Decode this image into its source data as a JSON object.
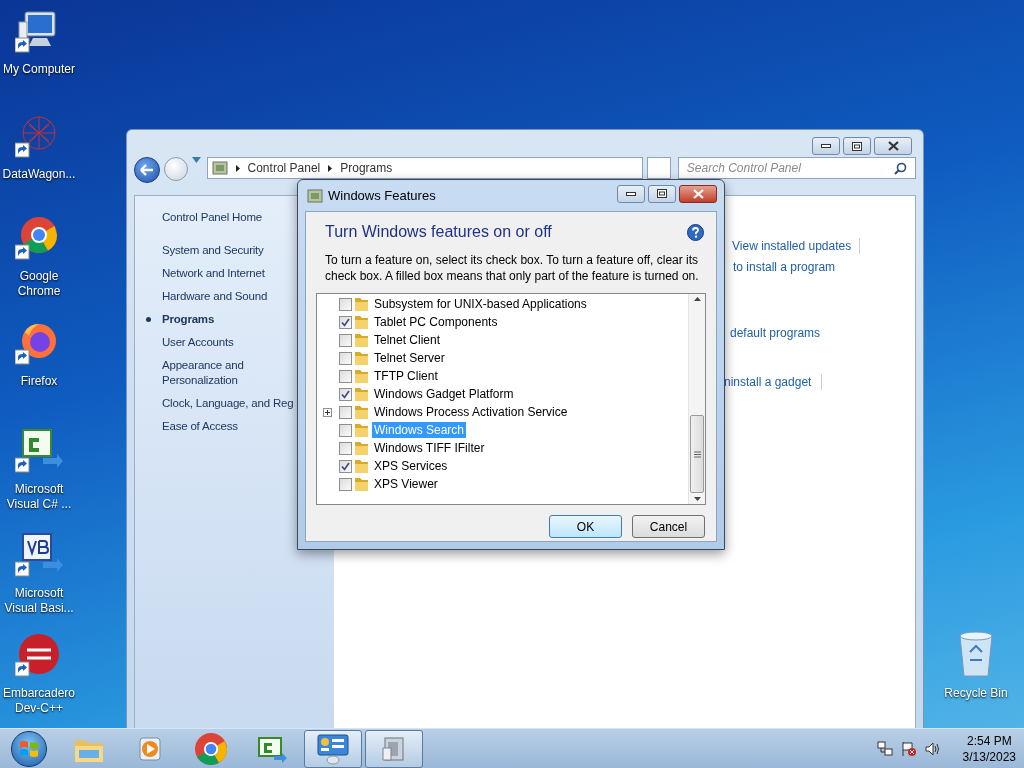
{
  "desktop_icons": [
    {
      "kind": "computer",
      "label": "My Computer"
    },
    {
      "kind": "network",
      "label": "DataWagon..."
    },
    {
      "kind": "chrome",
      "label": "Google Chrome"
    },
    {
      "kind": "firefox",
      "label": "Firefox"
    },
    {
      "kind": "csharp",
      "label": "Microsoft Visual C# ..."
    },
    {
      "kind": "vb",
      "label": "Microsoft Visual Basi..."
    },
    {
      "kind": "devcpp",
      "label": "Embarcadero Dev-C++"
    }
  ],
  "recycle_bin": {
    "label": "Recycle Bin"
  },
  "control_panel": {
    "breadcrumbs": [
      "Control Panel",
      "Programs"
    ],
    "search": {
      "placeholder": "Search Control Panel"
    },
    "nav": [
      {
        "label": "Control Panel Home",
        "selected": false
      },
      {
        "label": "System and Security",
        "selected": false
      },
      {
        "label": "Network and Internet",
        "selected": false
      },
      {
        "label": "Hardware and Sound",
        "selected": false
      },
      {
        "label": "Programs",
        "selected": true
      },
      {
        "label": "User Accounts",
        "selected": false
      },
      {
        "label": "Appearance and Personalization",
        "selected": false
      },
      {
        "label": "Clock, Language, and Reg",
        "selected": false
      },
      {
        "label": "Ease of Access",
        "selected": false
      }
    ],
    "links": [
      "View installed updates",
      "to install a program",
      "default programs",
      "ninstall a gadget"
    ]
  },
  "dialog": {
    "title": "Windows Features",
    "heading": "Turn Windows features on or off",
    "description": "To turn a feature on, select its check box. To turn a feature off, clear its check box. A filled box means that only part of the feature is turned on.",
    "features": [
      {
        "label": "Subsystem for UNIX-based Applications",
        "checked": false,
        "expandable": false,
        "selected": false
      },
      {
        "label": "Tablet PC Components",
        "checked": true,
        "expandable": false,
        "selected": false
      },
      {
        "label": "Telnet Client",
        "checked": false,
        "expandable": false,
        "selected": false
      },
      {
        "label": "Telnet Server",
        "checked": false,
        "expandable": false,
        "selected": false
      },
      {
        "label": "TFTP Client",
        "checked": false,
        "expandable": false,
        "selected": false
      },
      {
        "label": "Windows Gadget Platform",
        "checked": true,
        "expandable": false,
        "selected": false
      },
      {
        "label": "Windows Process Activation Service",
        "checked": false,
        "expandable": true,
        "selected": false
      },
      {
        "label": "Windows Search",
        "checked": false,
        "expandable": false,
        "selected": true
      },
      {
        "label": "Windows TIFF IFilter",
        "checked": false,
        "expandable": false,
        "selected": false
      },
      {
        "label": "XPS Services",
        "checked": true,
        "expandable": false,
        "selected": false
      },
      {
        "label": "XPS Viewer",
        "checked": false,
        "expandable": false,
        "selected": false
      }
    ],
    "buttons": [
      "OK",
      "Cancel"
    ]
  },
  "taskbar": {
    "apps": [
      {
        "kind": "explorer",
        "selected": false
      },
      {
        "kind": "media",
        "selected": false
      },
      {
        "kind": "chrome",
        "selected": false
      },
      {
        "kind": "csharp",
        "selected": false
      },
      {
        "kind": "control",
        "selected": true
      },
      {
        "kind": "features",
        "selected": true
      }
    ],
    "time": "2:54 PM",
    "date": "3/13/2023"
  }
}
